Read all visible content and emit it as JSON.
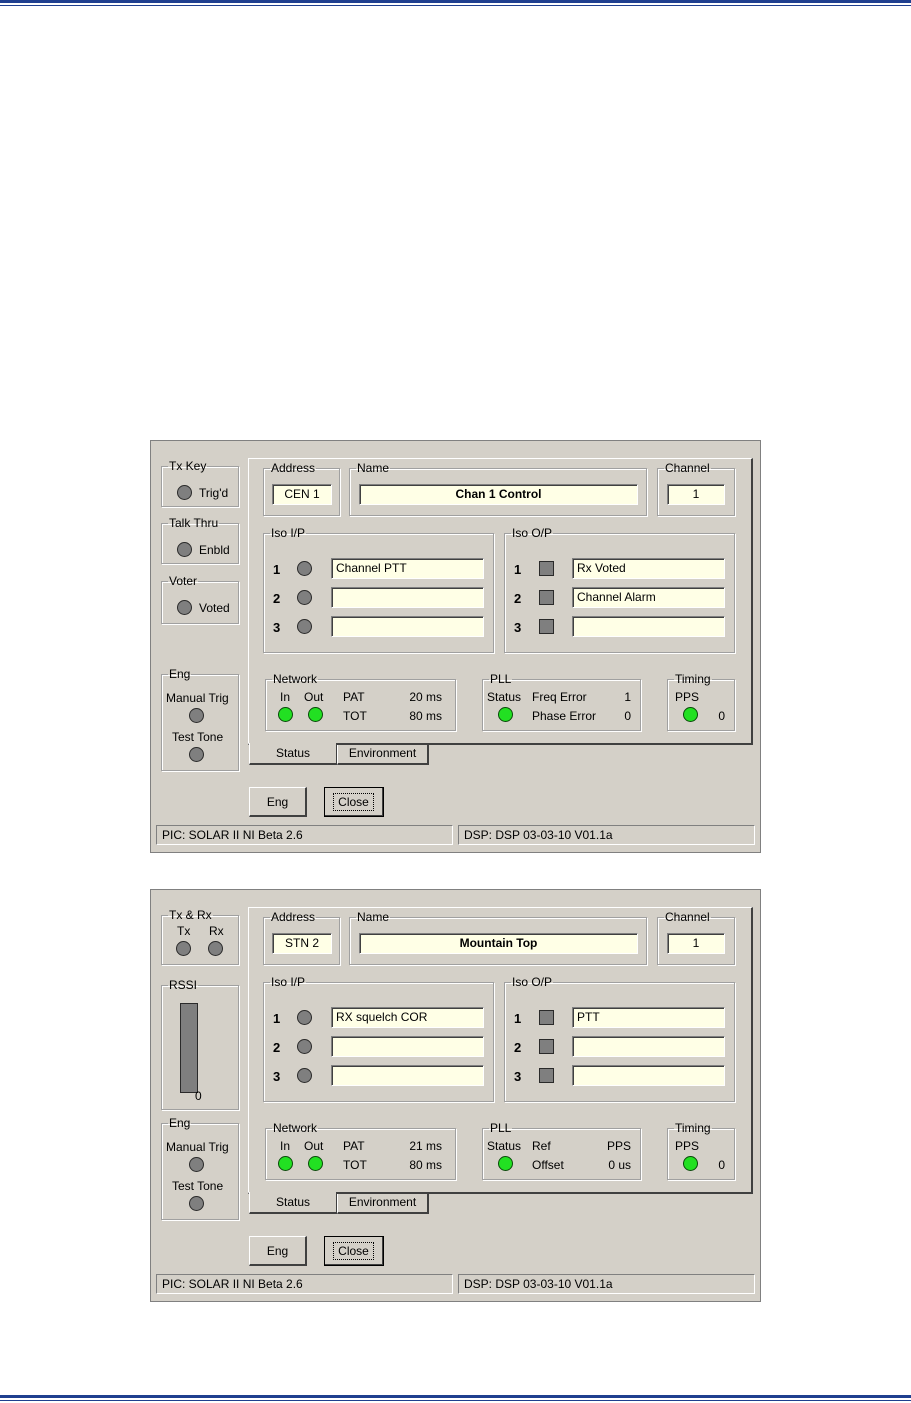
{
  "dialogs": [
    {
      "left_panel": {
        "group1": {
          "title": "Tx Key",
          "led_label": "Trig'd"
        },
        "group2": {
          "title": "Talk Thru",
          "led_label": "Enbld"
        },
        "group3": {
          "title": "Voter",
          "led_label": "Voted"
        },
        "eng": {
          "title": "Eng",
          "manual_trig": "Manual Trig",
          "test_tone": "Test Tone"
        }
      },
      "address": {
        "title": "Address",
        "value": "CEN 1"
      },
      "name": {
        "title": "Name",
        "value": "Chan 1 Control"
      },
      "channel": {
        "title": "Channel",
        "value": "1"
      },
      "iso_ip": {
        "title": "Iso I/P",
        "rows": [
          {
            "num": "1",
            "value": "Channel PTT"
          },
          {
            "num": "2",
            "value": ""
          },
          {
            "num": "3",
            "value": ""
          }
        ]
      },
      "iso_op": {
        "title": "Iso O/P",
        "rows": [
          {
            "num": "1",
            "value": "Rx Voted"
          },
          {
            "num": "2",
            "value": "Channel Alarm"
          },
          {
            "num": "3",
            "value": ""
          }
        ]
      },
      "network": {
        "title": "Network",
        "in": "In",
        "out": "Out",
        "pat_label": "PAT",
        "pat_value": "20 ms",
        "tot_label": "TOT",
        "tot_value": "80 ms"
      },
      "pll": {
        "title": "PLL",
        "status": "Status",
        "label1": "Freq Error",
        "value1": "1",
        "label2": "Phase Error",
        "value2": "0"
      },
      "timing": {
        "title": "Timing",
        "pps": "PPS",
        "value": "0"
      },
      "tabs": {
        "status": "Status",
        "environment": "Environment"
      },
      "buttons": {
        "eng": "Eng",
        "close": "Close"
      },
      "statusbar": {
        "pic": "PIC: SOLAR II NI Beta 2.6",
        "dsp": "DSP: DSP 03-03-10 V01.1a"
      }
    },
    {
      "left_panel": {
        "txrx": {
          "title": "Tx & Rx",
          "tx": "Tx",
          "rx": "Rx"
        },
        "rssi": {
          "title": "RSSI",
          "value": "0"
        },
        "eng": {
          "title": "Eng",
          "manual_trig": "Manual Trig",
          "test_tone": "Test Tone"
        }
      },
      "address": {
        "title": "Address",
        "value": "STN 2"
      },
      "name": {
        "title": "Name",
        "value": "Mountain Top"
      },
      "channel": {
        "title": "Channel",
        "value": "1"
      },
      "iso_ip": {
        "title": "Iso I/P",
        "rows": [
          {
            "num": "1",
            "value": "RX squelch COR"
          },
          {
            "num": "2",
            "value": ""
          },
          {
            "num": "3",
            "value": ""
          }
        ]
      },
      "iso_op": {
        "title": "Iso O/P",
        "rows": [
          {
            "num": "1",
            "value": "PTT"
          },
          {
            "num": "2",
            "value": ""
          },
          {
            "num": "3",
            "value": ""
          }
        ]
      },
      "network": {
        "title": "Network",
        "in": "In",
        "out": "Out",
        "pat_label": "PAT",
        "pat_value": "21 ms",
        "tot_label": "TOT",
        "tot_value": "80 ms"
      },
      "pll": {
        "title": "PLL",
        "status": "Status",
        "label1": "Ref",
        "value1": "PPS",
        "label2": "Offset",
        "value2": "0 us"
      },
      "timing": {
        "title": "Timing",
        "pps": "PPS",
        "value": "0"
      },
      "tabs": {
        "status": "Status",
        "environment": "Environment"
      },
      "buttons": {
        "eng": "Eng",
        "close": "Close"
      },
      "statusbar": {
        "pic": "PIC: SOLAR II NI Beta 2.6",
        "dsp": "DSP: DSP 03-03-10 V01.1a"
      }
    }
  ]
}
